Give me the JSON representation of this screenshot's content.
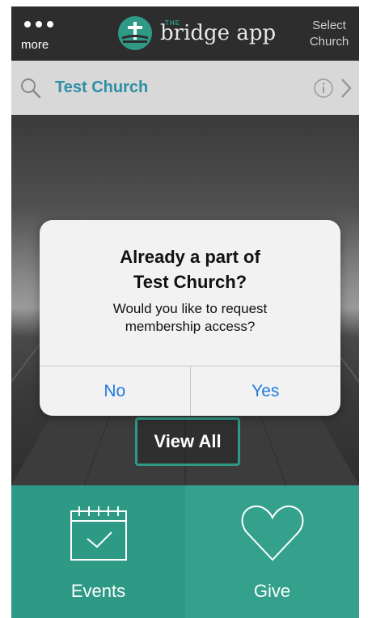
{
  "header": {
    "more_label": "more",
    "logo_the": "THE",
    "logo_text": "bridge app",
    "select_church_line1": "Select",
    "select_church_line2": "Church"
  },
  "search": {
    "church_name": "Test Church"
  },
  "hero": {
    "view_all_label": "View All"
  },
  "tiles": [
    {
      "label": "Events",
      "icon": "calendar-check-icon"
    },
    {
      "label": "Give",
      "icon": "heart-icon"
    }
  ],
  "dialog": {
    "title_line1": "Already a part of",
    "title_line2": "Test Church?",
    "message_line1": "Would you like to request",
    "message_line2": "membership access?",
    "no_label": "No",
    "yes_label": "Yes"
  },
  "colors": {
    "brand_teal": "#2e9a86",
    "link_blue": "#1f7ae0",
    "church_name_blue": "#2f8fa5",
    "topbar_dark": "#2d2d2d"
  }
}
